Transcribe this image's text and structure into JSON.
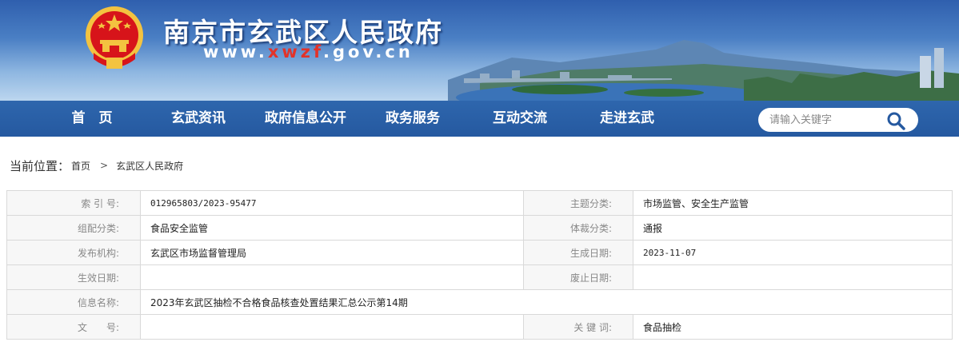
{
  "site": {
    "title": "南京市玄武区人民政府",
    "url_prefix": "www.",
    "url_highlight": "xwzf",
    "url_suffix": ".gov.cn"
  },
  "nav": {
    "items": [
      "首　页",
      "玄武资讯",
      "政府信息公开",
      "政务服务",
      "互动交流",
      "走进玄武"
    ]
  },
  "search": {
    "placeholder": "请输入关键字"
  },
  "breadcrumb": {
    "label": "当前位置：",
    "home": "首页",
    "current": "玄武区人民政府"
  },
  "info": {
    "index_label": "索 引 号:",
    "index_value": "012965803/2023-95477",
    "topic_label": "主题分类:",
    "topic_value": "市场监管、安全生产监管",
    "org_cat_label": "组配分类:",
    "org_cat_value": "食品安全监管",
    "genre_label": "体裁分类:",
    "genre_value": "通报",
    "publisher_label": "发布机构:",
    "publisher_value": "玄武区市场监督管理局",
    "created_label": "生成日期:",
    "created_value": "2023-11-07",
    "effective_label": "生效日期:",
    "effective_value": "",
    "abolish_label": "废止日期:",
    "abolish_value": "",
    "name_label": "信息名称:",
    "name_value": "2023年玄武区抽检不合格食品核查处置结果汇总公示第14期",
    "docno_label": "文　　号:",
    "docno_value": "",
    "keywords_label": "关 键 词:",
    "keywords_value": "食品抽检"
  },
  "colors": {
    "nav_bg": "#2559a0",
    "banner_top": "#2f5fae",
    "url_highlight": "#e2332a",
    "emblem_red": "#d7141a",
    "emblem_gold": "#f3c340"
  }
}
